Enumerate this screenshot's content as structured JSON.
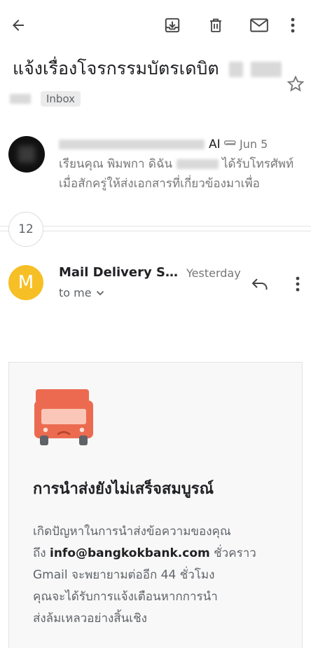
{
  "toolbar": {
    "back_icon": "arrow-left-icon",
    "archive_icon": "archive-icon",
    "delete_icon": "trash-icon",
    "mark_unread_icon": "mail-icon",
    "more_icon": "more-vert-icon"
  },
  "thread": {
    "subject": "แจ้งเรื่องโจรกรรมบัตรเดบิต",
    "label": "Inbox",
    "star_icon": "star-outline-icon"
  },
  "message1": {
    "sender_visible": "AI",
    "attachment_icon": "paperclip-icon",
    "date": "Jun 5",
    "snippet_part1": "เรียนคุณ พิมพกา ดิฉัน",
    "snippet_part2": "ได้รับโทรศัพท์",
    "snippet_line2": "เมื่อสักครู่ให้ส่งเอกสารที่เกี่ยวข้องมาเพื่อ"
  },
  "collapsed": {
    "count": "12"
  },
  "message2": {
    "avatar_letter": "M",
    "avatar_color": "#f6bf26",
    "sender": "Mail Delivery Su...",
    "date": "Yesterday",
    "to": "to me",
    "reply_icon": "reply-icon",
    "more_icon": "more-vert-icon",
    "chevron_icon": "chevron-down-icon"
  },
  "bounce": {
    "truck_icon": "delivery-truck-sad-icon",
    "title": "การนำส่งยังไม่เสร็จสมบูรณ์",
    "line1": "เกิดปัญหาในการนำส่งข้อความของคุณ",
    "line2_prefix": "ถึง",
    "email": "info@bangkokbank.com",
    "line2_suffix": "ชั่วคราว",
    "line3": "Gmail จะพยายามต่ออีก 44 ชั่วโมง",
    "line4": "คุณจะได้รับการแจ้งเตือนหากการนำ",
    "line5": "ส่งล้มเหลวอย่างสิ้นเชิง"
  },
  "colors": {
    "truck": "#ec6b50",
    "truck_window": "#f9c6b8"
  }
}
